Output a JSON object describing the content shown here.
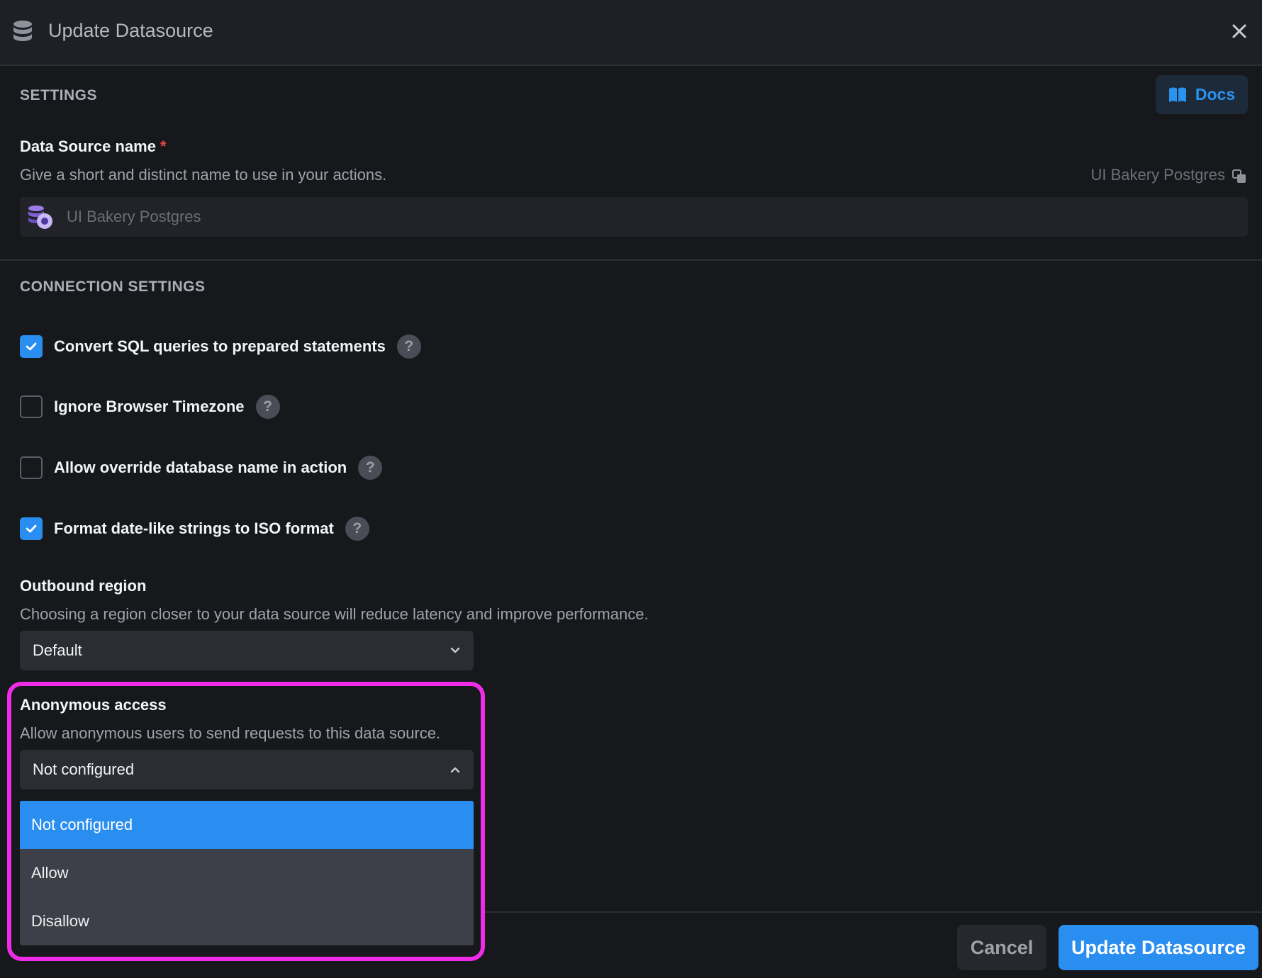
{
  "header": {
    "title": "Update Datasource",
    "icon": "database-icon",
    "close_icon": "close-icon"
  },
  "settings": {
    "section_title": "SETTINGS",
    "docs_label": "Docs",
    "name_label": "Data Source name",
    "required_mark": "*",
    "name_hint": "Give a short and distinct name to use in your actions.",
    "name_right_value": "UI Bakery Postgres",
    "name_placeholder": "UI Bakery Postgres"
  },
  "connection": {
    "section_title": "CONNECTION SETTINGS",
    "checkboxes": [
      {
        "label": "Convert SQL queries to prepared statements",
        "checked": true
      },
      {
        "label": "Ignore Browser Timezone",
        "checked": false
      },
      {
        "label": "Allow override database name in action",
        "checked": false
      },
      {
        "label": "Format date-like strings to ISO format",
        "checked": true
      }
    ],
    "help_glyph": "?"
  },
  "outbound": {
    "label": "Outbound region",
    "hint": "Choosing a region closer to your data source will reduce latency and improve performance.",
    "value": "Default"
  },
  "anonymous": {
    "label": "Anonymous access",
    "hint": "Allow anonymous users to send requests to this data source.",
    "value": "Not configured",
    "options": [
      "Not configured",
      "Allow",
      "Disallow"
    ],
    "selected_index": 0
  },
  "footer": {
    "cancel_label": "Cancel",
    "update_label": "Update Datasource"
  },
  "colors": {
    "accent": "#2a8ef0",
    "highlight": "#ee2be6",
    "background": "#17181c"
  }
}
